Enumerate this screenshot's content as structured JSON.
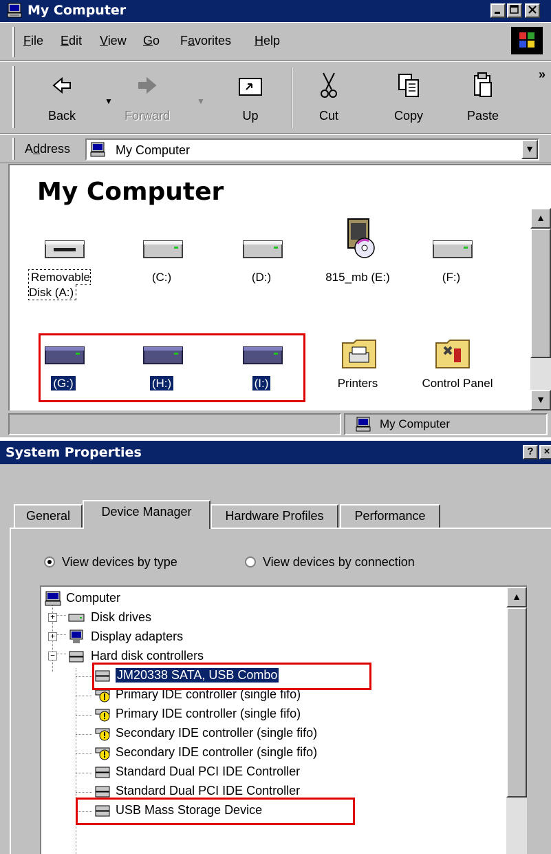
{
  "explorer": {
    "title": "My Computer",
    "menu": [
      "File",
      "Edit",
      "View",
      "Go",
      "Favorites",
      "Help"
    ],
    "menu_access": [
      "F",
      "E",
      "V",
      "G",
      "a",
      "H"
    ],
    "toolbar": {
      "back": "Back",
      "forward": "Forward",
      "up": "Up",
      "cut": "Cut",
      "copy": "Copy",
      "paste": "Paste",
      "more": "»"
    },
    "address": {
      "label": "Address",
      "value": "My Computer"
    },
    "heading": "My Computer",
    "items": [
      {
        "label": "Removable Disk (A:)",
        "icon": "floppy-drive-icon",
        "selected": false,
        "focused": true
      },
      {
        "label": "(C:)",
        "icon": "hard-drive-icon",
        "selected": false
      },
      {
        "label": "(D:)",
        "icon": "hard-drive-icon",
        "selected": false
      },
      {
        "label": "815_mb (E:)",
        "icon": "cd-drive-icon",
        "selected": false
      },
      {
        "label": "(F:)",
        "icon": "hard-drive-icon",
        "selected": false
      },
      {
        "label": "(G:)",
        "icon": "hard-drive-icon",
        "selected": true
      },
      {
        "label": "(H:)",
        "icon": "hard-drive-icon",
        "selected": true
      },
      {
        "label": "(I:)",
        "icon": "hard-drive-icon",
        "selected": true
      },
      {
        "label": "Printers",
        "icon": "printers-folder-icon",
        "selected": false
      },
      {
        "label": "Control Panel",
        "icon": "control-panel-folder-icon",
        "selected": false
      }
    ],
    "status": "My Computer",
    "highlight_color": "#e00000"
  },
  "system_properties": {
    "title": "System Properties",
    "help_button": "?",
    "close_button": "×",
    "tabs": [
      "General",
      "Device Manager",
      "Hardware Profiles",
      "Performance"
    ],
    "active_tab": "Device Manager",
    "view_options": [
      {
        "label": "View devices by type",
        "selected": true
      },
      {
        "label": "View devices by connection",
        "selected": false
      }
    ],
    "tree": {
      "root": "Computer",
      "categories": [
        {
          "label": "Disk drives",
          "expanded": false
        },
        {
          "label": "Display adapters",
          "expanded": false
        },
        {
          "label": "Hard disk controllers",
          "expanded": true
        }
      ],
      "controllers": [
        {
          "label": "JM20338 SATA, USB Combo",
          "warning": false,
          "selected": true
        },
        {
          "label": "Primary IDE controller (single fifo)",
          "warning": true
        },
        {
          "label": "Primary IDE controller (single fifo)",
          "warning": true
        },
        {
          "label": "Secondary IDE controller (single fifo)",
          "warning": true
        },
        {
          "label": "Secondary IDE controller (single fifo)",
          "warning": true
        },
        {
          "label": "Standard Dual PCI IDE Controller",
          "warning": false
        },
        {
          "label": "Standard Dual PCI IDE Controller",
          "warning": false
        },
        {
          "label": "USB Mass Storage Device",
          "warning": false
        }
      ]
    }
  }
}
